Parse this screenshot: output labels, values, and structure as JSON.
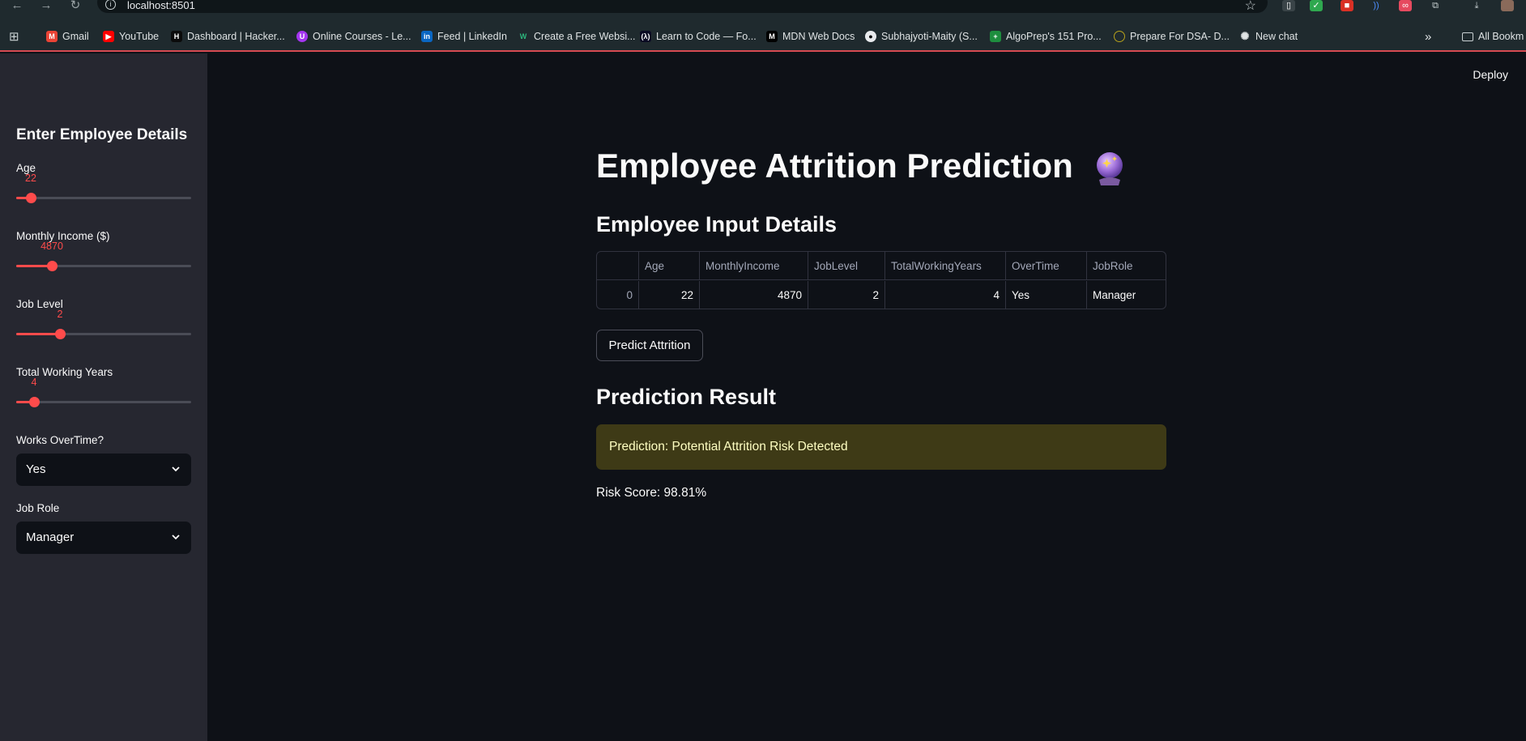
{
  "browser": {
    "url": "localhost:8501",
    "bookmarks": [
      "Gmail",
      "YouTube",
      "Dashboard | Hacker...",
      "Online Courses - Le...",
      "Feed | LinkedIn",
      "Create a Free Websi...",
      "Learn to Code — Fo...",
      "MDN Web Docs",
      "Subhajyoti-Maity (S...",
      "AlgoPrep's 151 Pro...",
      "Prepare For DSA- D...",
      "New chat"
    ],
    "all_bookmarks": "All Bookm"
  },
  "sidebar": {
    "title": "Enter Employee Details",
    "age": {
      "label": "Age",
      "value": "22",
      "fraction": 0.083
    },
    "income": {
      "label": "Monthly Income ($)",
      "value": "4870",
      "fraction": 0.205
    },
    "job_level": {
      "label": "Job Level",
      "value": "2",
      "fraction": 0.25
    },
    "working_years": {
      "label": "Total Working Years",
      "value": "4",
      "fraction": 0.1
    },
    "overtime": {
      "label": "Works OverTime?",
      "value": "Yes"
    },
    "job_role": {
      "label": "Job Role",
      "value": "Manager"
    }
  },
  "header": {
    "deploy": "Deploy"
  },
  "main": {
    "title": "Employee Attrition Prediction",
    "input_heading": "Employee Input Details",
    "table": {
      "columns": [
        "",
        "Age",
        "MonthlyIncome",
        "JobLevel",
        "TotalWorkingYears",
        "OverTime",
        "JobRole"
      ],
      "row": [
        "0",
        "22",
        "4870",
        "2",
        "4",
        "Yes",
        "Manager"
      ]
    },
    "predict_button": "Predict Attrition",
    "result_heading": "Prediction Result",
    "alert": "Prediction: Potential Attrition Risk Detected",
    "risk_score": "Risk Score: 98.81%"
  },
  "colors": {
    "accent": "#ff4b4b",
    "background": "#0e1117",
    "sidebar": "#262730",
    "warning_bg": "#3e3a16",
    "warning_text": "#ffffc2"
  }
}
